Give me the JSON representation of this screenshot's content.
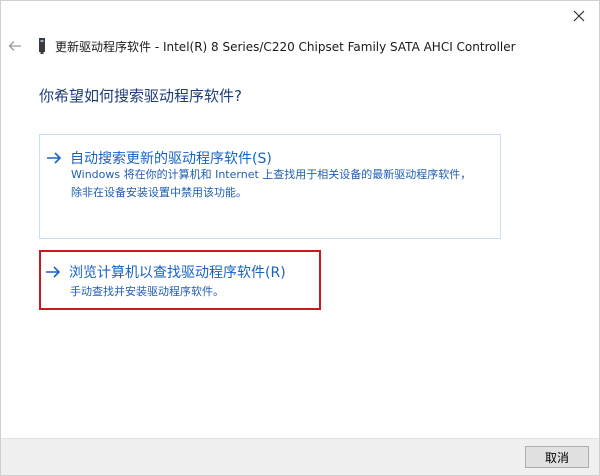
{
  "header": {
    "close_icon": "close-icon",
    "back_icon": "back-arrow-icon",
    "device_icon": "device-icon",
    "title": "更新驱动程序软件 - Intel(R) 8 Series/C220 Chipset Family SATA AHCI Controller"
  },
  "main": {
    "heading": "你希望如何搜索驱动程序软件?",
    "options": [
      {
        "icon": "arrow-right-icon",
        "title": "自动搜索更新的驱动程序软件(S)",
        "description": "Windows 将在你的计算机和 Internet 上查找用于相关设备的最新驱动程序软件，除非在设备安装设置中禁用该功能。"
      },
      {
        "icon": "arrow-right-icon",
        "title": "浏览计算机以查找驱动程序软件(R)",
        "description": "手动查找并安装驱动程序软件。",
        "highlight_color": "#c8191e"
      }
    ]
  },
  "footer": {
    "cancel_label": "取消"
  },
  "colors": {
    "heading": "#1e3c78",
    "link": "#1863c4",
    "highlight_border": "#c8191e"
  }
}
